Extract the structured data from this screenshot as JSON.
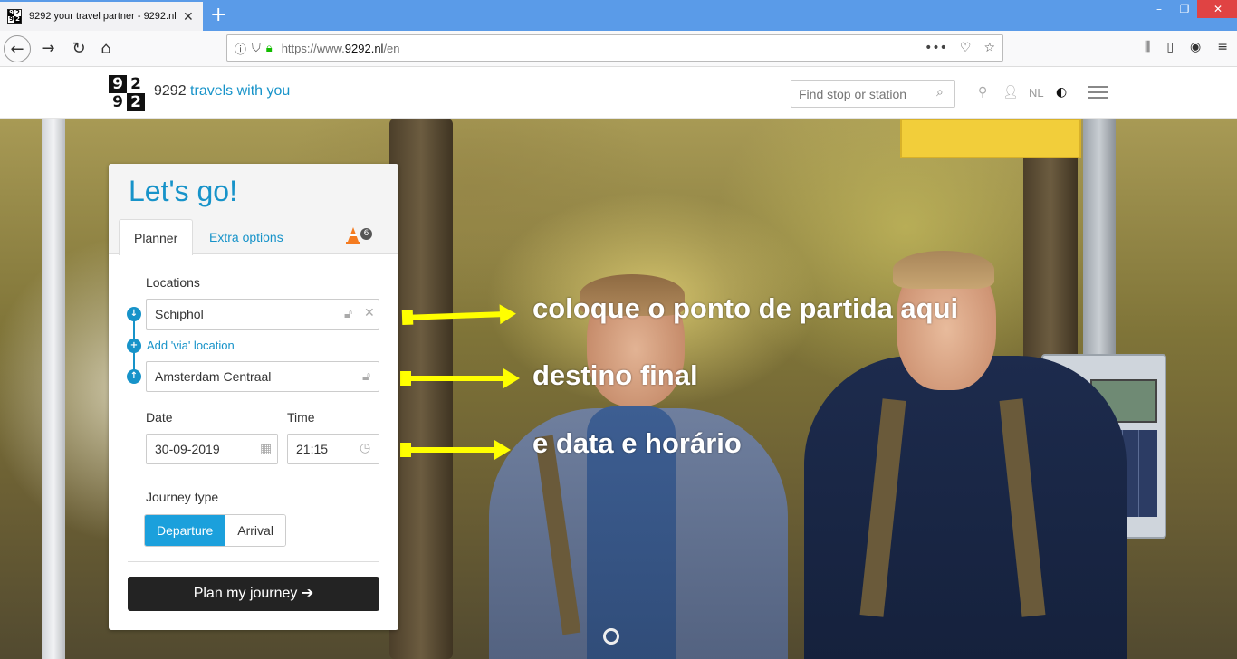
{
  "browser": {
    "tab_title": "9292 your travel partner - 9292.nl",
    "tab_favicon": [
      "9",
      "2",
      "9",
      "2"
    ],
    "new_tab": "+",
    "url_host": "https://www.",
    "url_domain": "9292.nl",
    "url_path": "/en",
    "window_controls": [
      "–",
      "❐",
      "✕"
    ]
  },
  "site": {
    "logo_digits": [
      "9",
      "2",
      "9",
      "2"
    ],
    "tagline_number": "9292",
    "tagline_text": "travels with you",
    "search_placeholder": "Find stop or station",
    "language": "NL"
  },
  "planner": {
    "title": "Let's go!",
    "tabs": {
      "planner": "Planner",
      "extra": "Extra options"
    },
    "disruption_count": "6",
    "locations_label": "Locations",
    "from_value": "Schiphol",
    "via_label": "Add 'via' location",
    "to_value": "Amsterdam Centraal",
    "date_label": "Date",
    "date_value": "30-09-2019",
    "time_label": "Time",
    "time_value": "21:15",
    "journey_type_label": "Journey type",
    "journey_types": {
      "departure": "Departure",
      "arrival": "Arrival"
    },
    "plan_button": "Plan my journey ➔"
  },
  "annotations": {
    "start": "coloque o ponto de partida aqui",
    "destination": "destino final",
    "datetime": "e data e horário",
    "color": "#ffff00"
  },
  "colors": {
    "accent": "#1793c9",
    "titlebar": "#5a9be8",
    "button_dark": "#232323",
    "segment_active": "#1ba0dc"
  }
}
